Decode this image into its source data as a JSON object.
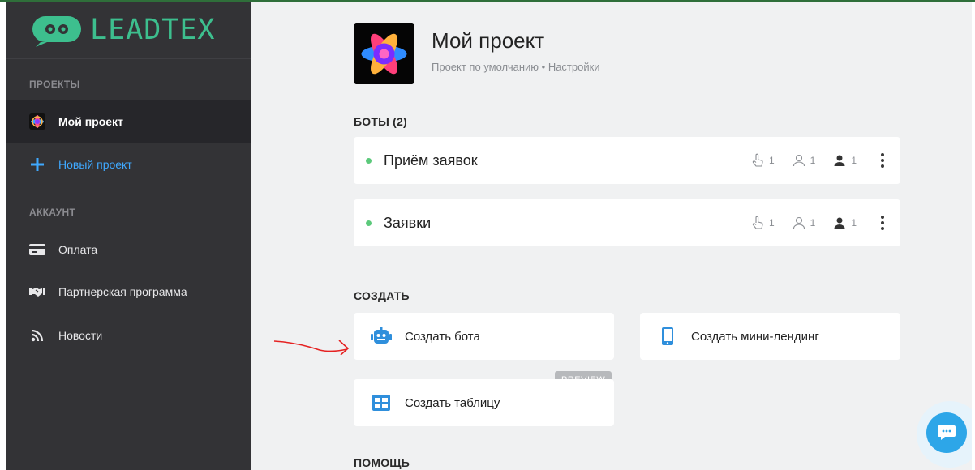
{
  "brand": {
    "logo_text": "LEADTEX",
    "accent": "#3dbf8e"
  },
  "sidebar": {
    "projects_label": "ПРОЕКТЫ",
    "account_label": "АККАУНТ",
    "items": [
      {
        "label": "Мой проект",
        "icon": "project-flower-icon",
        "active": true
      },
      {
        "label": "Новый проект",
        "icon": "plus-icon"
      },
      {
        "label": "Оплата",
        "icon": "credit-card-icon"
      },
      {
        "label": "Партнерская программа",
        "icon": "handshake-icon"
      },
      {
        "label": "Новости",
        "icon": "rss-icon"
      }
    ]
  },
  "project": {
    "title": "Мой проект",
    "subtitle": "Проект по умолчанию • Настройки"
  },
  "bots": {
    "title": "БОТЫ (2)",
    "items": [
      {
        "name": "Приём заявок",
        "status_color": "#5cc97b",
        "stats": [
          "1",
          "1",
          "1"
        ]
      },
      {
        "name": "Заявки",
        "status_color": "#5cc97b",
        "stats": [
          "1",
          "1",
          "1"
        ]
      }
    ]
  },
  "create": {
    "title": "СОЗДАТЬ",
    "items": [
      {
        "label": "Создать бота",
        "icon": "robot-icon"
      },
      {
        "label": "Создать мини-лендинг",
        "icon": "phone-icon"
      },
      {
        "label": "Создать таблицу",
        "icon": "table-icon",
        "badge": "PREVIEW"
      }
    ]
  },
  "help": {
    "title": "ПОМОЩЬ"
  },
  "colors": {
    "sidebar_bg": "#333336",
    "main_bg": "#f0f1f2",
    "link_blue": "#3fa9ff",
    "chat_blue": "#2da6e8"
  }
}
